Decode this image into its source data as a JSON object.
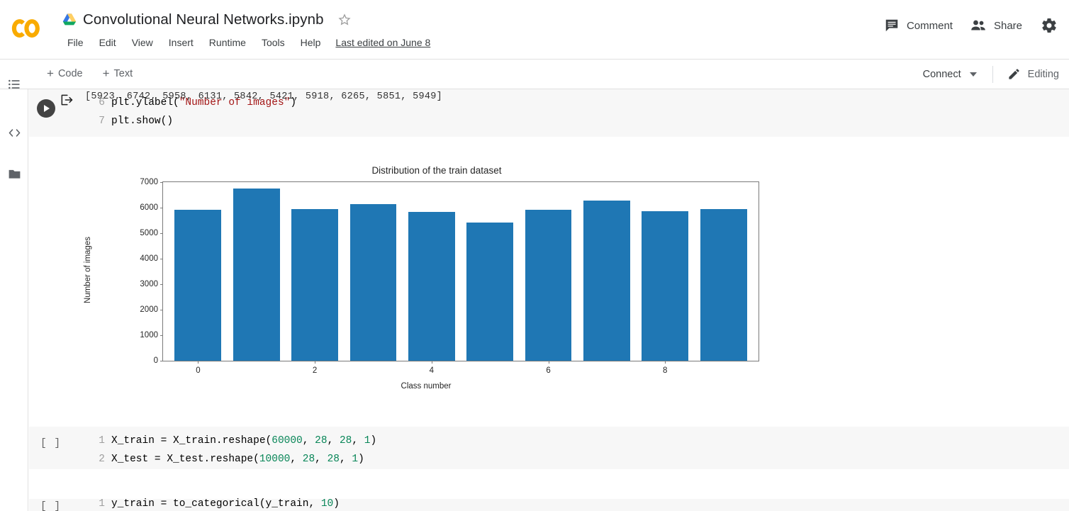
{
  "header": {
    "logo_name": "colab-logo",
    "drive_icon": "drive-icon",
    "doc_title": "Convolutional Neural Networks.ipynb",
    "star_icon": "star-icon",
    "menu": [
      "File",
      "Edit",
      "View",
      "Insert",
      "Runtime",
      "Tools",
      "Help"
    ],
    "last_edited": "Last edited on June 8",
    "comment_label": "Comment",
    "comment_icon": "comment-icon",
    "share_label": "Share",
    "share_icon": "people-icon",
    "settings_icon": "gear-icon"
  },
  "toolbar": {
    "add_code": "Code",
    "add_text": "Text",
    "plus": "+",
    "connect_label": "Connect",
    "editing_label": "Editing",
    "pencil_icon": "pencil-icon",
    "caret_icon": "chevron-down-icon"
  },
  "sidebar": {
    "items": [
      {
        "name": "table-of-contents-icon",
        "label": "Table of contents"
      },
      {
        "name": "code-snippets-icon",
        "label": "Code snippets"
      },
      {
        "name": "files-icon",
        "label": "Files"
      }
    ]
  },
  "cells": {
    "top": {
      "run_icon": "run-button",
      "lines": [
        {
          "num": "6",
          "parts": [
            {
              "t": "plt.ylabel(",
              "k": "plain"
            },
            {
              "t": "\"Number of images\"",
              "k": "str"
            },
            {
              "t": ")",
              "k": "plain"
            }
          ]
        },
        {
          "num": "7",
          "parts": [
            {
              "t": "plt.show()",
              "k": "plain"
            }
          ]
        }
      ]
    },
    "cell2": {
      "index_label": "[ ]",
      "lines": [
        {
          "num": "1",
          "parts": [
            {
              "t": "X_train = X_train.reshape(",
              "k": "plain"
            },
            {
              "t": "60000",
              "k": "num"
            },
            {
              "t": ", ",
              "k": "plain"
            },
            {
              "t": "28",
              "k": "num"
            },
            {
              "t": ", ",
              "k": "plain"
            },
            {
              "t": "28",
              "k": "num"
            },
            {
              "t": ", ",
              "k": "plain"
            },
            {
              "t": "1",
              "k": "num"
            },
            {
              "t": ")",
              "k": "plain"
            }
          ]
        },
        {
          "num": "2",
          "parts": [
            {
              "t": "X_test = X_test.reshape(",
              "k": "plain"
            },
            {
              "t": "10000",
              "k": "num"
            },
            {
              "t": ", ",
              "k": "plain"
            },
            {
              "t": "28",
              "k": "num"
            },
            {
              "t": ", ",
              "k": "plain"
            },
            {
              "t": "28",
              "k": "num"
            },
            {
              "t": ", ",
              "k": "plain"
            },
            {
              "t": "1",
              "k": "num"
            },
            {
              "t": ")",
              "k": "plain"
            }
          ]
        }
      ]
    },
    "cell3": {
      "index_label": "[ ]",
      "lines": [
        {
          "num": "1",
          "parts": [
            {
              "t": "y_train = to_categorical(y_train, ",
              "k": "plain"
            },
            {
              "t": "10",
              "k": "num"
            },
            {
              "t": ")",
              "k": "plain"
            }
          ]
        }
      ]
    }
  },
  "output": {
    "icon": "output-arrow-icon",
    "text": "[5923, 6742, 5958, 6131, 5842, 5421, 5918, 6265, 5851, 5949]"
  },
  "chart_data": {
    "type": "bar",
    "title": "Distribution of the train dataset",
    "xlabel": "Class number",
    "ylabel": "Number of images",
    "categories": [
      0,
      1,
      2,
      3,
      4,
      5,
      6,
      7,
      8,
      9
    ],
    "values": [
      5923,
      6742,
      5958,
      6131,
      5842,
      5421,
      5918,
      6265,
      5851,
      5949
    ],
    "xticks": [
      0,
      2,
      4,
      6,
      8
    ],
    "yticks": [
      0,
      1000,
      2000,
      3000,
      4000,
      5000,
      6000,
      7000
    ],
    "ylim": [
      0,
      7000
    ],
    "xlim": [
      -0.6,
      9.6
    ],
    "bar_color": "#1f77b4",
    "grid": false,
    "legend": null
  }
}
